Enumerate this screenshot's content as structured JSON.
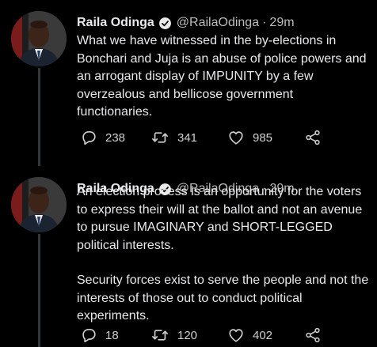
{
  "tweets": [
    {
      "author_name": "Raila Odinga",
      "handle": "@RailaOdinga",
      "time": "29m",
      "separator": "·",
      "paragraphs": [
        "What we have witnessed in the by-elections in Bonchari and Juja is an abuse of police powers and an arrogant display of IMPUNITY by a few overzealous and bellicose government functionaries."
      ],
      "replies": "238",
      "retweets": "341",
      "likes": "985"
    },
    {
      "author_name": "Raila Odinga",
      "handle": "@RailaOdinga",
      "time": "29m",
      "separator": "·",
      "paragraphs": [
        "An election process is an opportunity for the voters to express their will at the ballot and not an avenue to pursue IMAGINARY and SHORT-LEGGED political interests.",
        "Security forces exist to serve the people and not the interests of those out to conduct political experiments."
      ],
      "replies": "18",
      "retweets": "120",
      "likes": "402"
    }
  ],
  "icons": {
    "reply": "reply-icon",
    "retweet": "retweet-icon",
    "like": "like-icon",
    "share": "share-icon",
    "verified": "verified-badge-icon"
  },
  "colors": {
    "background": "#000000",
    "text": "#e7e9ea",
    "secondary_text": "#bcbcbc",
    "thread_line": "#333639"
  }
}
